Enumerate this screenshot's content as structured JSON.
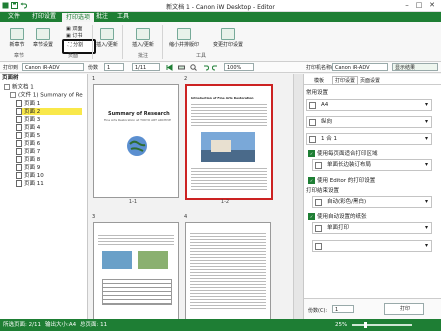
{
  "window": {
    "title": "新文档 1 - Canon iW Desktop - Editor",
    "min": "–",
    "max": "□",
    "close": "✕"
  },
  "menu": {
    "tabs": [
      "文件",
      "打印设置",
      "打印选项",
      "批注",
      "工具"
    ],
    "active_index": 2
  },
  "ribbon": {
    "buttons": {
      "new_chapter": "新章节",
      "paper_settings": "章节设置",
      "duplex": "双面",
      "collate": "订书",
      "shift": "偏移",
      "split": "分割",
      "insert_update": "插入/更新",
      "reduce_layout": "缩小并排版印",
      "change_print_settings": "变更打印设置",
      "pages_per_sheet": "页面设置",
      "insert": "插入/更新"
    },
    "groups": [
      "章节",
      "页面",
      "批注",
      "工具"
    ]
  },
  "toolbar": {
    "print_label": "打印到",
    "printer": "Canon iR-ADV",
    "copies_label": "份数",
    "copies": "1",
    "pages": "1/11",
    "zoom": "100%",
    "right_printer_label": "打印机名称(N):",
    "right_printer": "Canon iR-ADV",
    "show_result": "显示结果"
  },
  "tree": {
    "header": "页面树",
    "root": "新文档 1",
    "doc": "(文件 1) Summary of Re",
    "pages": [
      "页面 1",
      "页面 2",
      "页面 3",
      "页面 4",
      "页面 5",
      "页面 6",
      "页面 7",
      "页面 8",
      "页面 9",
      "页面 10",
      "页面 11"
    ],
    "selected_index": 1
  },
  "preview": {
    "pages": [
      {
        "num": "1",
        "caption": "1-1",
        "heading": "Summary of Research",
        "sub": "Fine Arts Restoration at TOKYO ART ARCHIVE"
      },
      {
        "num": "2",
        "caption": "1-2",
        "heading": "Introduction of Fine Arts Restoration"
      },
      {
        "num": "3",
        "caption": "",
        "heading": ""
      },
      {
        "num": "4",
        "caption": "",
        "heading": ""
      }
    ]
  },
  "settings": {
    "tabs": [
      "模板",
      "打印设置",
      "页面设置"
    ],
    "active_tab": 1,
    "section_common": "常用设置",
    "paper": "A4",
    "orientation": "纵向",
    "layout": "1 合 1",
    "check1": "使用每页面适合打印区域",
    "duplex": "单面长边装订布局",
    "check2": "使用 Editor 的打印设置",
    "section_finish": "打印结束设置",
    "color_mode": "自动(彩色/黑白)",
    "check3": "使用自动设置的纸张",
    "single_side": "单面打印",
    "copies_label": "份数(C):",
    "copies": "1",
    "print_button": "打印"
  },
  "status": {
    "selected": "所选页面: 2/11",
    "size": "输出大小:A4",
    "total": "总页面: 11",
    "zoom": "25%"
  },
  "colors": {
    "brand": "#1e7e34",
    "selection": "#f9e84a"
  }
}
